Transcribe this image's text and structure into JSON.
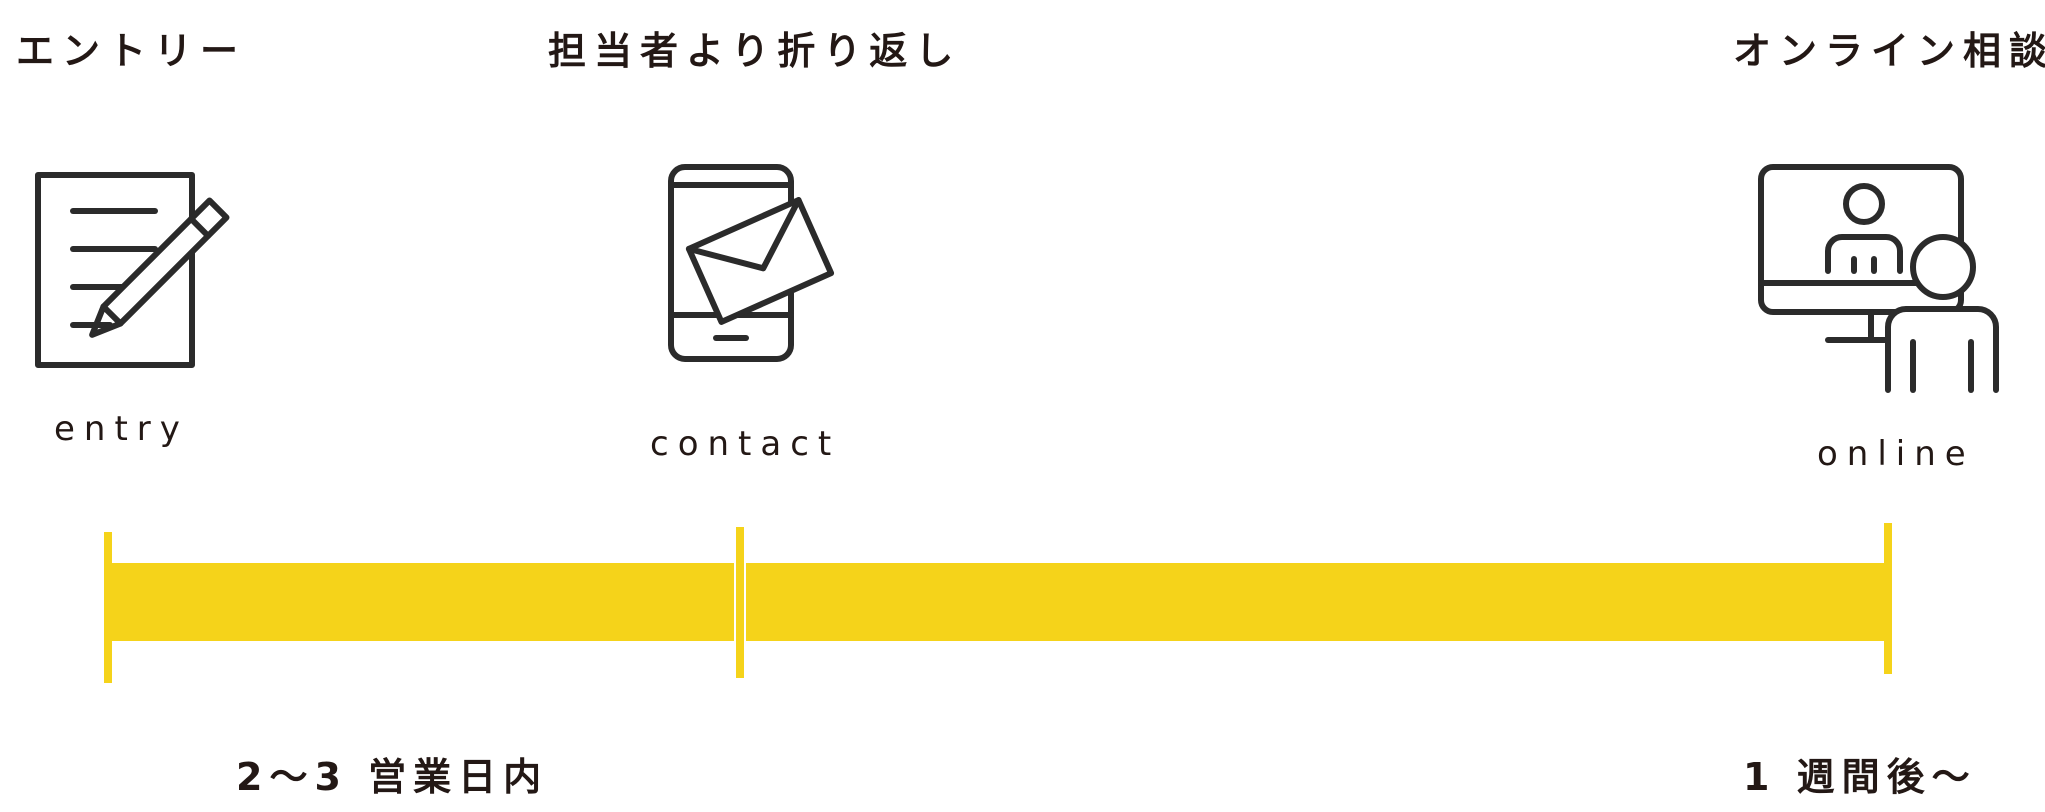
{
  "steps": [
    {
      "title": "エントリー",
      "sub": "entry",
      "icon": "entry-form-pencil-icon"
    },
    {
      "title": "担当者より折り返し",
      "sub": "contact",
      "icon": "smartphone-mail-icon"
    },
    {
      "title": "オンライン相談",
      "sub": "online",
      "icon": "online-consultation-icon"
    }
  ],
  "durations": {
    "first": "2～3 営業日内",
    "second": "1 週間後～"
  },
  "colors": {
    "bar": "#f5d31a",
    "text": "#231815",
    "icon_stroke": "#2b2b2b"
  }
}
